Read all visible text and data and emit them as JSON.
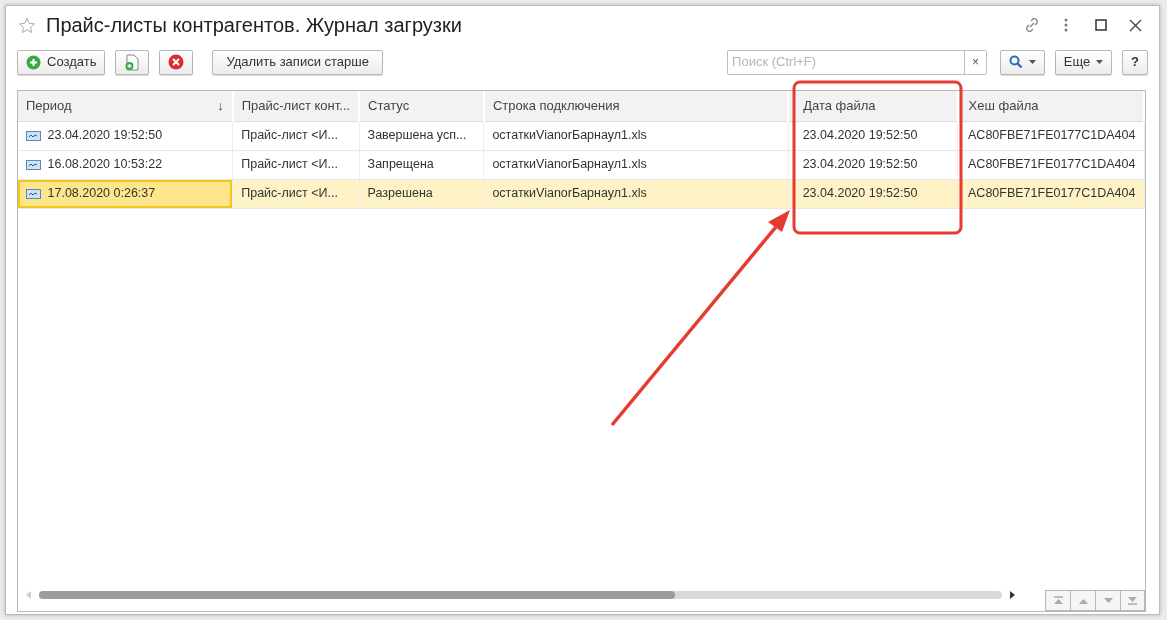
{
  "window": {
    "title": "Прайс-листы контрагентов. Журнал загрузки",
    "favorite": false
  },
  "toolbar": {
    "create_label": "Создать",
    "delete_older_label": "Удалить записи старше",
    "search": {
      "placeholder": "Поиск (Ctrl+F)",
      "clear": "×"
    },
    "more_label": "Еще",
    "help_label": "?"
  },
  "table": {
    "columns": [
      {
        "label": "Период",
        "sort_mark": "↓"
      },
      {
        "label": "Прайс-лист конт..."
      },
      {
        "label": "Статус"
      },
      {
        "label": "Строка подключения"
      },
      {
        "label": "Дата файла"
      },
      {
        "label": "Хеш файла"
      }
    ],
    "rows": [
      {
        "selected": false,
        "cells": [
          "23.04.2020 19:52:50",
          "Прайс-лист <И...",
          "Завершена усп...",
          "остаткиVianorБарнаул1.xls",
          "23.04.2020 19:52:50",
          "AC80FBE71FE0177C1DA404"
        ]
      },
      {
        "selected": false,
        "cells": [
          "16.08.2020 10:53:22",
          "Прайс-лист <И...",
          "Запрещена",
          "остаткиVianorБарнаул1.xls",
          "23.04.2020 19:52:50",
          "AC80FBE71FE0177C1DA404"
        ]
      },
      {
        "selected": true,
        "cells": [
          "17.08.2020 0:26:37",
          "Прайс-лист <И...",
          "Разрешена",
          "остаткиVianorБарнаул1.xls",
          "23.04.2020 19:52:50",
          "AC80FBE71FE0177C1DA404"
        ]
      }
    ]
  }
}
